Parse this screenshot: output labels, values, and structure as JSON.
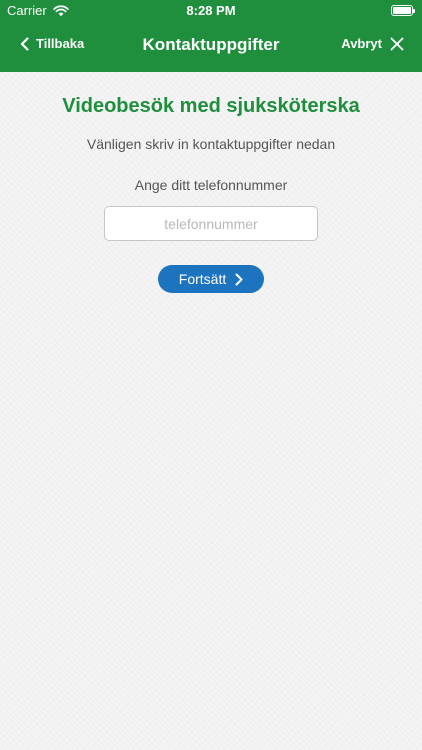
{
  "colors": {
    "brand_green": "#1f8f3e",
    "button_blue": "#1c73be"
  },
  "status_bar": {
    "carrier": "Carrier",
    "time": "8:28 PM",
    "icons": [
      "wifi-icon",
      "battery-icon"
    ]
  },
  "nav": {
    "back_label": "Tillbaka",
    "back_icon": "chevron-left-icon",
    "title": "Kontaktuppgifter",
    "cancel_label": "Avbryt",
    "cancel_icon": "close-icon"
  },
  "content": {
    "heading": "Videobesök med sjuksköterska",
    "subheading": "Vänligen skriv in kontaktuppgifter nedan",
    "phone_label": "Ange ditt telefonnummer",
    "phone_value": "",
    "phone_placeholder": "telefonnummer",
    "continue_label": "Fortsätt",
    "continue_icon": "chevron-right-icon"
  }
}
